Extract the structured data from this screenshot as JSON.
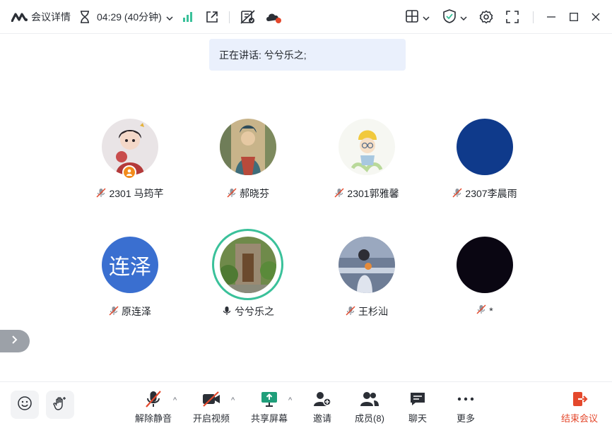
{
  "titlebar": {
    "meeting_details": "会议详情",
    "timer": "04:29 (40分钟)"
  },
  "speaking_banner": "正在讲话: 兮兮乐之;",
  "participants": [
    {
      "name": "2301 马筠芊",
      "host": true
    },
    {
      "name": "郝晓芬"
    },
    {
      "name": "2301郭雅馨"
    },
    {
      "name": "2307李晨雨"
    },
    {
      "name": "原连泽",
      "avatar_text": "连泽"
    },
    {
      "name": "兮兮乐之",
      "speaking": true
    },
    {
      "name": "王杉汕"
    },
    {
      "name": "*"
    }
  ],
  "toolbar": {
    "unmute": "解除静音",
    "start_video": "开启视频",
    "share_screen": "共享屏幕",
    "invite": "邀请",
    "members": "成员(8)",
    "chat": "聊天",
    "more": "更多",
    "end": "结束会议"
  },
  "colors": {
    "accent_green": "#3ac19a",
    "end_red": "#e4482c",
    "banner_bg": "#eaf0fc",
    "host_badge": "#f28b1b"
  }
}
